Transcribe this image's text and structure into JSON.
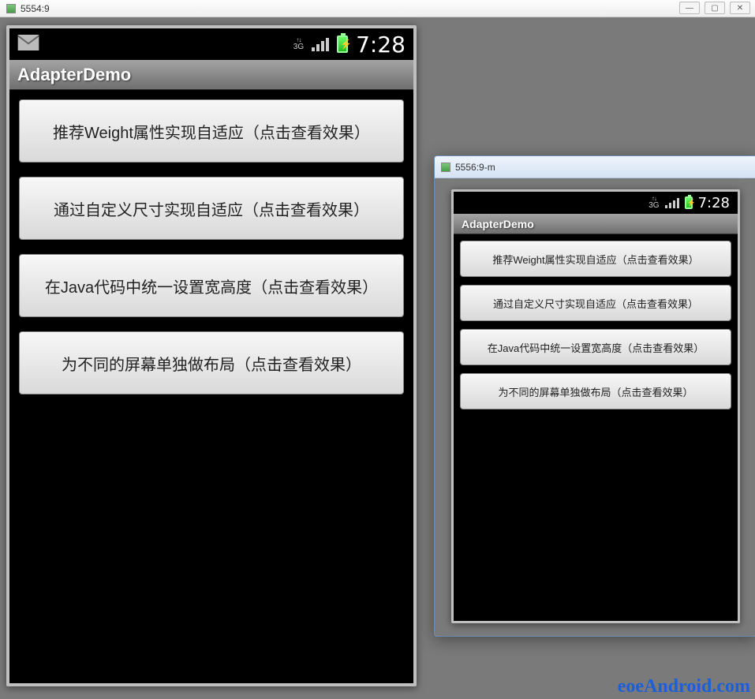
{
  "main_window": {
    "title": "5554:9"
  },
  "secondary_window": {
    "title": "5556:9-m"
  },
  "status": {
    "network": "3G",
    "time": "7:28"
  },
  "app": {
    "title": "AdapterDemo",
    "buttons": [
      "推荐Weight属性实现自适应（点击查看效果）",
      "通过自定义尺寸实现自适应（点击查看效果）",
      "在Java代码中统一设置宽高度（点击查看效果）",
      "为不同的屏幕单独做布局（点击查看效果）"
    ]
  },
  "watermark": "eoeAndroid.com"
}
